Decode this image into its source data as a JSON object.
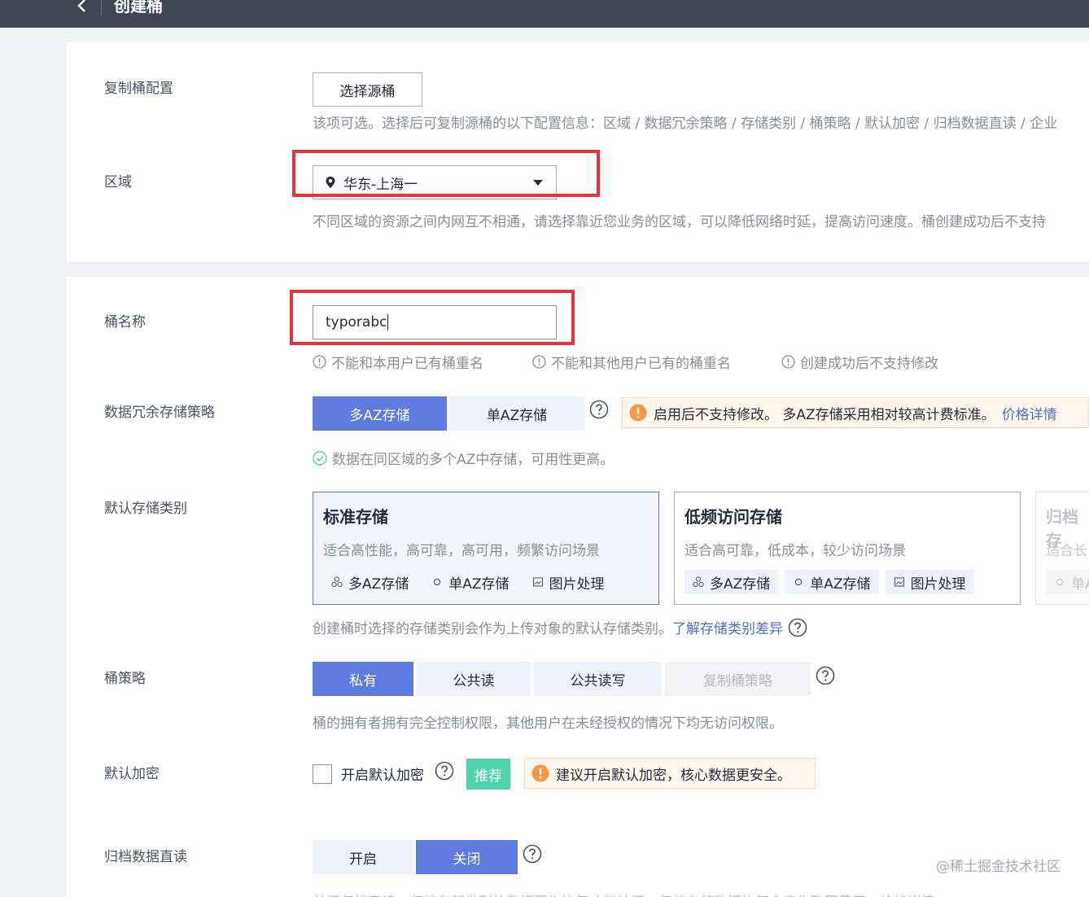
{
  "header": {
    "title": "创建桶"
  },
  "copy_config": {
    "label": "复制桶配置",
    "button": "选择源桶",
    "hint": "该项可选。选择后可复制源桶的以下配置信息：区域 / 数据冗余策略 / 存储类别 / 桶策略 / 默认加密 / 归档数据直读 / 企业"
  },
  "region": {
    "label": "区域",
    "value": "华东-上海一",
    "hint": "不同区域的资源之间内网互不相通，请选择靠近您业务的区域，可以降低网络时延，提高访问速度。桶创建成功后不支持"
  },
  "bucket_name": {
    "label": "桶名称",
    "value": "typorabc",
    "rules": [
      "不能和本用户已有桶重名",
      "不能和其他用户已有的桶重名",
      "创建成功后不支持修改"
    ]
  },
  "redundancy": {
    "label": "数据冗余存储策略",
    "options": [
      "多AZ存储",
      "单AZ存储"
    ],
    "warning": "启用后不支持修改。 多AZ存储采用相对较高计费标准。",
    "warning_link": "价格详情",
    "ok_hint": "数据在同区域的多个AZ中存储，可用性更高。"
  },
  "storage_class": {
    "label": "默认存储类别",
    "cards": [
      {
        "title": "标准存储",
        "desc": "适合高性能，高可靠，高可用，频繁访问场景",
        "tags": [
          "多AZ存储",
          "单AZ存储",
          "图片处理"
        ]
      },
      {
        "title": "低频访问存储",
        "desc": "适合高可靠，低成本，较少访问场景",
        "tags": [
          "多AZ存储",
          "单AZ存储",
          "图片处理"
        ]
      },
      {
        "title": "归档存",
        "desc": "适合长",
        "tags": [
          "单A"
        ]
      }
    ],
    "hint": "创建桶时选择的存储类别会作为上传对象的默认存储类别。",
    "link": "了解存储类别差异"
  },
  "policy": {
    "label": "桶策略",
    "options": [
      "私有",
      "公共读",
      "公共读写",
      "复制桶策略"
    ],
    "hint": "桶的拥有者拥有完全控制权限，其他用户在未经授权的情况下均无访问权限。"
  },
  "encryption": {
    "label": "默认加密",
    "checkbox_label": "开启默认加密",
    "badge": "推荐",
    "warning": "建议开启默认加密，核心数据更安全。"
  },
  "archive": {
    "label": "归档数据直读",
    "options": [
      "开启",
      "关闭"
    ],
    "cutoff": "关闭归档直读，归档存储类别的数据要先恢复才能访问。归档存储数据恢复会产生取回费用。价格详情"
  },
  "watermark": "@稀土掘金技术社区"
}
